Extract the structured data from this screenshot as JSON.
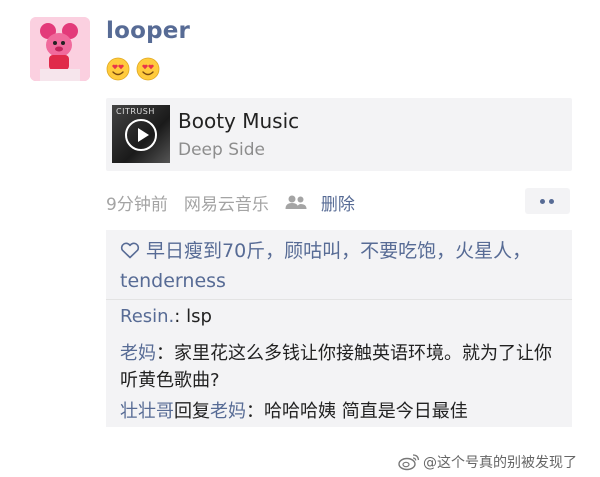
{
  "post": {
    "username": "looper",
    "emojis": [
      "smiling-face-with-heart-eyes-icon",
      "smiling-face-with-heart-eyes-icon"
    ],
    "music_card": {
      "cover_label": "CITRUSH",
      "title": "Booty Music",
      "artist": "Deep Side"
    },
    "meta": {
      "time": "9分钟前",
      "source": "网易云音乐",
      "delete_label": "删除"
    }
  },
  "likes": {
    "text": "早日瘦到70斤，顾咕叫，不要吃饱，火星人，tenderness"
  },
  "comments": [
    {
      "name": "Resin.",
      "separator": ": ",
      "text": "lsp"
    },
    {
      "name": "老妈",
      "separator": "：",
      "text": "家里花这么多钱让你接触英语环境。就为了让你听黄色歌曲?"
    },
    {
      "name": "壮壮哥",
      "reply_word": "回复",
      "reply_to": "老妈",
      "separator": "：",
      "text": "哈哈哈姨 简直是今日最佳"
    }
  ],
  "watermark": {
    "text": "@这个号真的别被发现了"
  },
  "colors": {
    "link": "#576b95",
    "box": "#f3f3f5",
    "meta": "#a4a4a4"
  }
}
